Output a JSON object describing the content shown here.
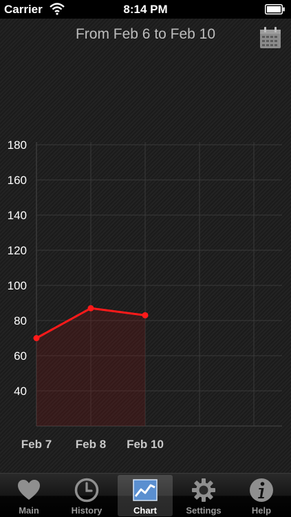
{
  "status_bar": {
    "carrier": "Carrier",
    "time": "8:14 PM"
  },
  "header": {
    "date_range": "From Feb 6 to Feb 10"
  },
  "chart_data": {
    "type": "line",
    "categories": [
      "Feb 7",
      "Feb 8",
      "Feb 10"
    ],
    "series": [
      {
        "values": [
          70,
          87,
          83
        ],
        "color": "#ff1a1a"
      }
    ],
    "yticks": [
      40,
      60,
      80,
      100,
      120,
      140,
      160,
      180
    ],
    "ylim": [
      20,
      180
    ],
    "grid": true,
    "title": "",
    "xlabel": "",
    "ylabel": ""
  },
  "tab_bar": {
    "tabs": [
      {
        "label": "Main",
        "icon": "heart-icon",
        "active": false
      },
      {
        "label": "History",
        "icon": "clock-icon",
        "active": false
      },
      {
        "label": "Chart",
        "icon": "chart-icon",
        "active": true
      },
      {
        "label": "Settings",
        "icon": "gear-icon",
        "active": false
      },
      {
        "label": "Help",
        "icon": "info-icon",
        "active": false
      }
    ]
  },
  "colors": {
    "accent_line": "#ff1a1a",
    "background": "#1b1b1b"
  }
}
